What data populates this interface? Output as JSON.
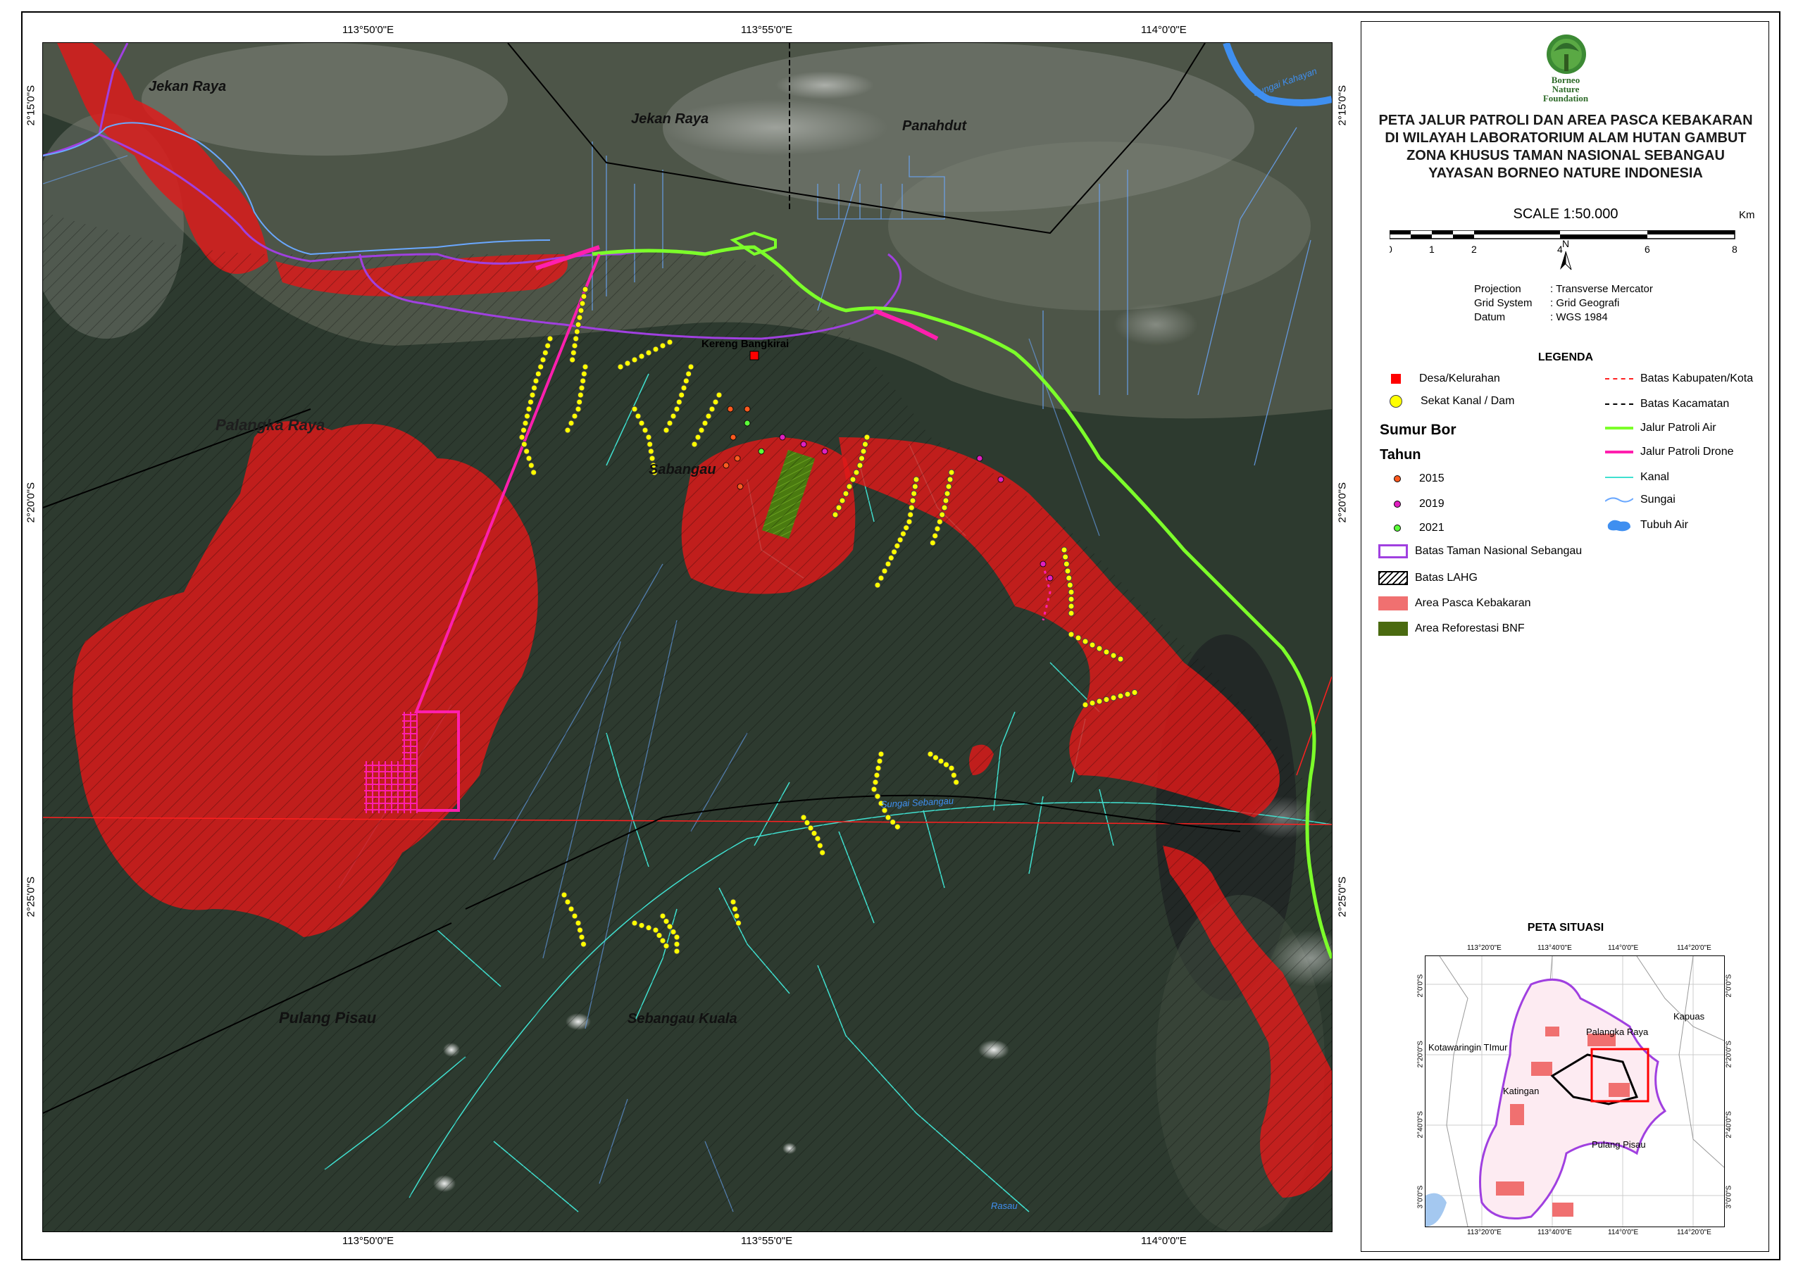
{
  "map": {
    "coordinates": {
      "top": [
        "113°50'0\"E",
        "113°55'0\"E",
        "114°0'0\"E"
      ],
      "bottom": [
        "113°50'0\"E",
        "113°55'0\"E",
        "114°0'0\"E"
      ],
      "left": [
        "2°15'0\"S",
        "2°20'0\"S",
        "2°25'0\"S"
      ],
      "right": [
        "2°15'0\"S",
        "2°20'0\"S",
        "2°25'0\"S"
      ]
    },
    "place_labels": {
      "jekan_raya_1": "Jekan Raya",
      "jekan_raya_2": "Jekan Raya",
      "panahdut": "Panahdut",
      "palangka_raya": "Palangka Raya",
      "sabangau": "Sabangau",
      "kereng_bangkirai": "Kereng Bangkirai",
      "pulang_pisau": "Pulang Pisau",
      "sebangau_kuala": "Sebangau Kuala"
    },
    "river_labels": {
      "sebangau": "Sungai Sebangau",
      "rasau": "Rasau",
      "kahayan": "Sungai Kahayan"
    },
    "colors": {
      "burn_area": "#e01818",
      "reforestation": "#4a7a10",
      "water_patrol": "#7cff2a",
      "drone_patrol": "#ff1fae",
      "national_park_boundary": "#a040e0",
      "canal": "#40e0d0",
      "river": "#6aa8ff",
      "dam": "#ffff00"
    }
  },
  "side": {
    "logo_text": [
      "Borneo",
      "Nature",
      "Foundation"
    ],
    "title_lines": [
      "PETA JALUR PATROLI DAN AREA PASCA KEBAKARAN",
      "DI WILAYAH LABORATORIUM ALAM HUTAN GAMBUT",
      "ZONA KHUSUS TAMAN NASIONAL SEBANGAU",
      "YAYASAN BORNEO NATURE INDONESIA"
    ],
    "scale": "SCALE 1:50.000",
    "scale_ticks": [
      "0",
      "1",
      "2",
      "4",
      "6",
      "8"
    ],
    "scale_unit": "Km",
    "north": "N",
    "projection": [
      {
        "k": "Projection",
        "v": ": Transverse Mercator"
      },
      {
        "k": "Grid System",
        "v": ": Grid Geografi"
      },
      {
        "k": "Datum",
        "v": ": WGS 1984"
      }
    ],
    "legend_title": "LEGENDA",
    "legend_left": {
      "desa": "Desa/Kelurahan",
      "sekat": "Sekat Kanal / Dam",
      "sumur_bor": "Sumur Bor",
      "tahun": "Tahun",
      "y2015": "2015",
      "y2019": "2019",
      "y2021": "2021",
      "batas_tn": "Batas Taman Nasional Sebangau",
      "batas_lahg": "Batas LAHG",
      "area_pasca": "Area Pasca Kebakaran",
      "area_reforestasi": "Area Reforestasi BNF"
    },
    "legend_right": {
      "batas_kab": "Batas Kabupaten/Kota",
      "batas_kec": "Batas Kacamatan",
      "jalur_air": "Jalur Patroli Air",
      "jalur_drone": "Jalur Patroli Drone",
      "kanal": "Kanal",
      "sungai": "Sungai",
      "tubuh_air": "Tubuh Air"
    },
    "inset": {
      "title": "PETA SITUASI",
      "top_coords": [
        "113°20'0\"E",
        "113°40'0\"E",
        "114°0'0\"E",
        "114°20'0\"E"
      ],
      "bottom_coords": [
        "113°20'0\"E",
        "113°40'0\"E",
        "114°0'0\"E",
        "114°20'0\"E"
      ],
      "left_coords": [
        "2°0'0\"S",
        "2°20'0\"S",
        "2°40'0\"S",
        "3°0'0\"S"
      ],
      "right_coords": [
        "2°0'0\"S",
        "2°20'0\"S",
        "2°40'0\"S",
        "3°0'0\"S"
      ],
      "labels": {
        "kapuas": "Kapuas",
        "palangka_raya": "Palangka Raya",
        "kotawaringin": "Kotawaringin TImur",
        "katingan": "Katingan",
        "pulang_pisau": "Pulang Pisau"
      }
    }
  }
}
